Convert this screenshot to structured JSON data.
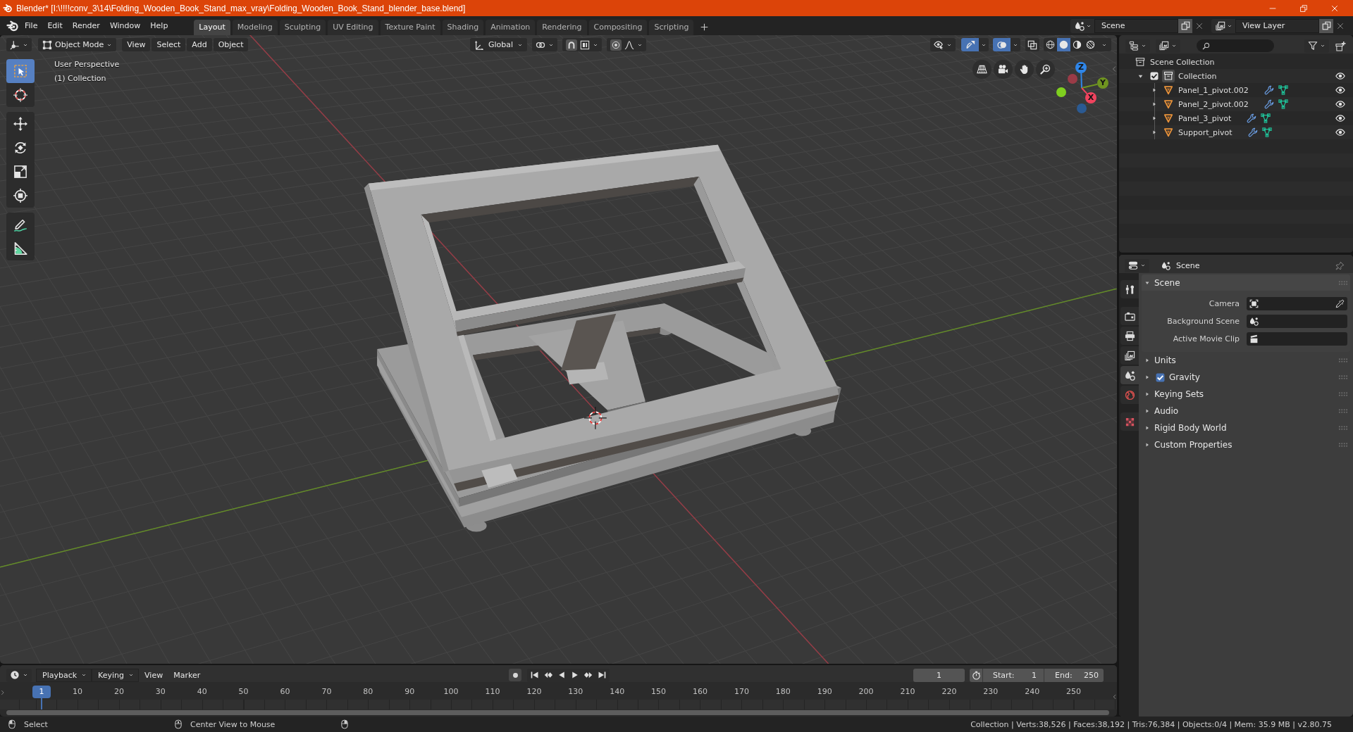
{
  "window": {
    "title": "Blender* [I:\\!!!!conv_3\\14\\Folding_Wooden_Book_Stand_max_vray\\Folding_Wooden_Book_Stand_blender_base.blend]"
  },
  "menu": [
    "File",
    "Edit",
    "Render",
    "Window",
    "Help"
  ],
  "workspaces": [
    {
      "label": "Layout",
      "selected": true
    },
    {
      "label": "Modeling",
      "selected": false
    },
    {
      "label": "Sculpting",
      "selected": false
    },
    {
      "label": "UV Editing",
      "selected": false
    },
    {
      "label": "Texture Paint",
      "selected": false
    },
    {
      "label": "Shading",
      "selected": false
    },
    {
      "label": "Animation",
      "selected": false
    },
    {
      "label": "Rendering",
      "selected": false
    },
    {
      "label": "Compositing",
      "selected": false
    },
    {
      "label": "Scripting",
      "selected": false
    }
  ],
  "scene": {
    "value": "Scene"
  },
  "view_layer": {
    "value": "View Layer"
  },
  "viewport": {
    "mode": "Object Mode",
    "menus": [
      "View",
      "Select",
      "Add",
      "Object"
    ],
    "orientation": "Global",
    "gizmos": true,
    "overlays": true,
    "xray": false,
    "shading": [
      {
        "kind": "wireframe",
        "selected": false
      },
      {
        "kind": "solid",
        "selected": true
      },
      {
        "kind": "material",
        "selected": false
      },
      {
        "kind": "rendered",
        "selected": false
      }
    ],
    "tool_groups": [
      {
        "tools": [
          {
            "kind": "select_box",
            "selected": true
          },
          {
            "kind": "cursor",
            "selected": false
          }
        ]
      },
      {
        "tools": [
          {
            "kind": "move",
            "selected": false
          },
          {
            "kind": "rotate",
            "selected": false
          },
          {
            "kind": "scale",
            "selected": false
          },
          {
            "kind": "transform",
            "selected": false
          }
        ]
      },
      {
        "tools": [
          {
            "kind": "annotate",
            "selected": false
          },
          {
            "kind": "measure",
            "selected": false
          }
        ]
      }
    ],
    "info": [
      "User Perspective",
      "(1) Collection"
    ],
    "axis_gizmo": {
      "positive": [
        {
          "kind": "z",
          "label": "Z",
          "color": "#2f86e9"
        },
        {
          "kind": "y",
          "label": "Y",
          "color": "#6f9420"
        },
        {
          "kind": "x",
          "label": "X",
          "color": "#f0435e"
        }
      ],
      "negative": [
        {
          "kind": "x",
          "color": "#9a3b47"
        },
        {
          "kind": "y",
          "color": "#7fcf1f"
        },
        {
          "kind": "z",
          "color": "#2b5a92"
        }
      ]
    }
  },
  "outliner": {
    "root": "Scene Collection",
    "collections": [
      {
        "name": "Collection",
        "expanded": true,
        "checked": true,
        "visible": true,
        "children": [
          {
            "name": "Panel_1_pivot.002",
            "expanded": false,
            "visible": true
          },
          {
            "name": "Panel_2_pivot.002",
            "expanded": false,
            "visible": true
          },
          {
            "name": "Panel_3_pivot",
            "expanded": false,
            "visible": true
          },
          {
            "name": "Support_pivot",
            "expanded": false,
            "visible": true
          }
        ]
      }
    ]
  },
  "properties": {
    "context": "Scene",
    "tab_groups": [
      {
        "tabs": [
          {
            "kind": "tool",
            "selected": false
          }
        ]
      },
      {
        "tabs": [
          {
            "kind": "render",
            "selected": false
          },
          {
            "kind": "output",
            "selected": false
          },
          {
            "kind": "view_layer",
            "selected": false
          },
          {
            "kind": "scene",
            "selected": true
          },
          {
            "kind": "world",
            "selected": false
          }
        ]
      },
      {
        "tabs": [
          {
            "kind": "texture",
            "selected": false
          }
        ]
      }
    ],
    "panels": [
      {
        "kind": "plain",
        "title": "Scene",
        "expanded": true,
        "fields": [
          {
            "label": "Camera",
            "kind": "camera"
          },
          {
            "label": "Background Scene",
            "kind": "scene"
          },
          {
            "label": "Active Movie Clip",
            "kind": "clip"
          }
        ]
      },
      {
        "kind": "plain",
        "title": "Units",
        "expanded": false
      },
      {
        "kind": "checkbox",
        "title": "Gravity",
        "expanded": false,
        "checked": true
      },
      {
        "kind": "plain",
        "title": "Keying Sets",
        "expanded": false
      },
      {
        "kind": "plain",
        "title": "Audio",
        "expanded": false
      },
      {
        "kind": "plain",
        "title": "Rigid Body World",
        "expanded": false
      },
      {
        "kind": "plain",
        "title": "Custom Properties",
        "expanded": false
      }
    ]
  },
  "timeline": {
    "menus": [
      {
        "label": "Playback",
        "kind": "dropdown"
      },
      {
        "label": "Keying",
        "kind": "dropdown"
      },
      {
        "label": "View",
        "kind": "menu"
      },
      {
        "label": "Marker",
        "kind": "menu"
      }
    ],
    "current_frame": "1",
    "start_label": "Start:",
    "start": "1",
    "end_label": "End:",
    "end": "250",
    "playhead": "1",
    "ruler": [
      "10",
      "20",
      "30",
      "40",
      "50",
      "60",
      "70",
      "80",
      "90",
      "100",
      "110",
      "120",
      "130",
      "140",
      "150",
      "160",
      "170",
      "180",
      "190",
      "200",
      "210",
      "220",
      "230",
      "240",
      "250"
    ]
  },
  "status_bar": {
    "hints": [
      "Select",
      "Center View to Mouse"
    ],
    "stats": "Collection | Verts:38,526 | Faces:38,192 | Tris:76,384 | Objects:0/4 | Mem: 35.9 MB | v2.80.75"
  }
}
